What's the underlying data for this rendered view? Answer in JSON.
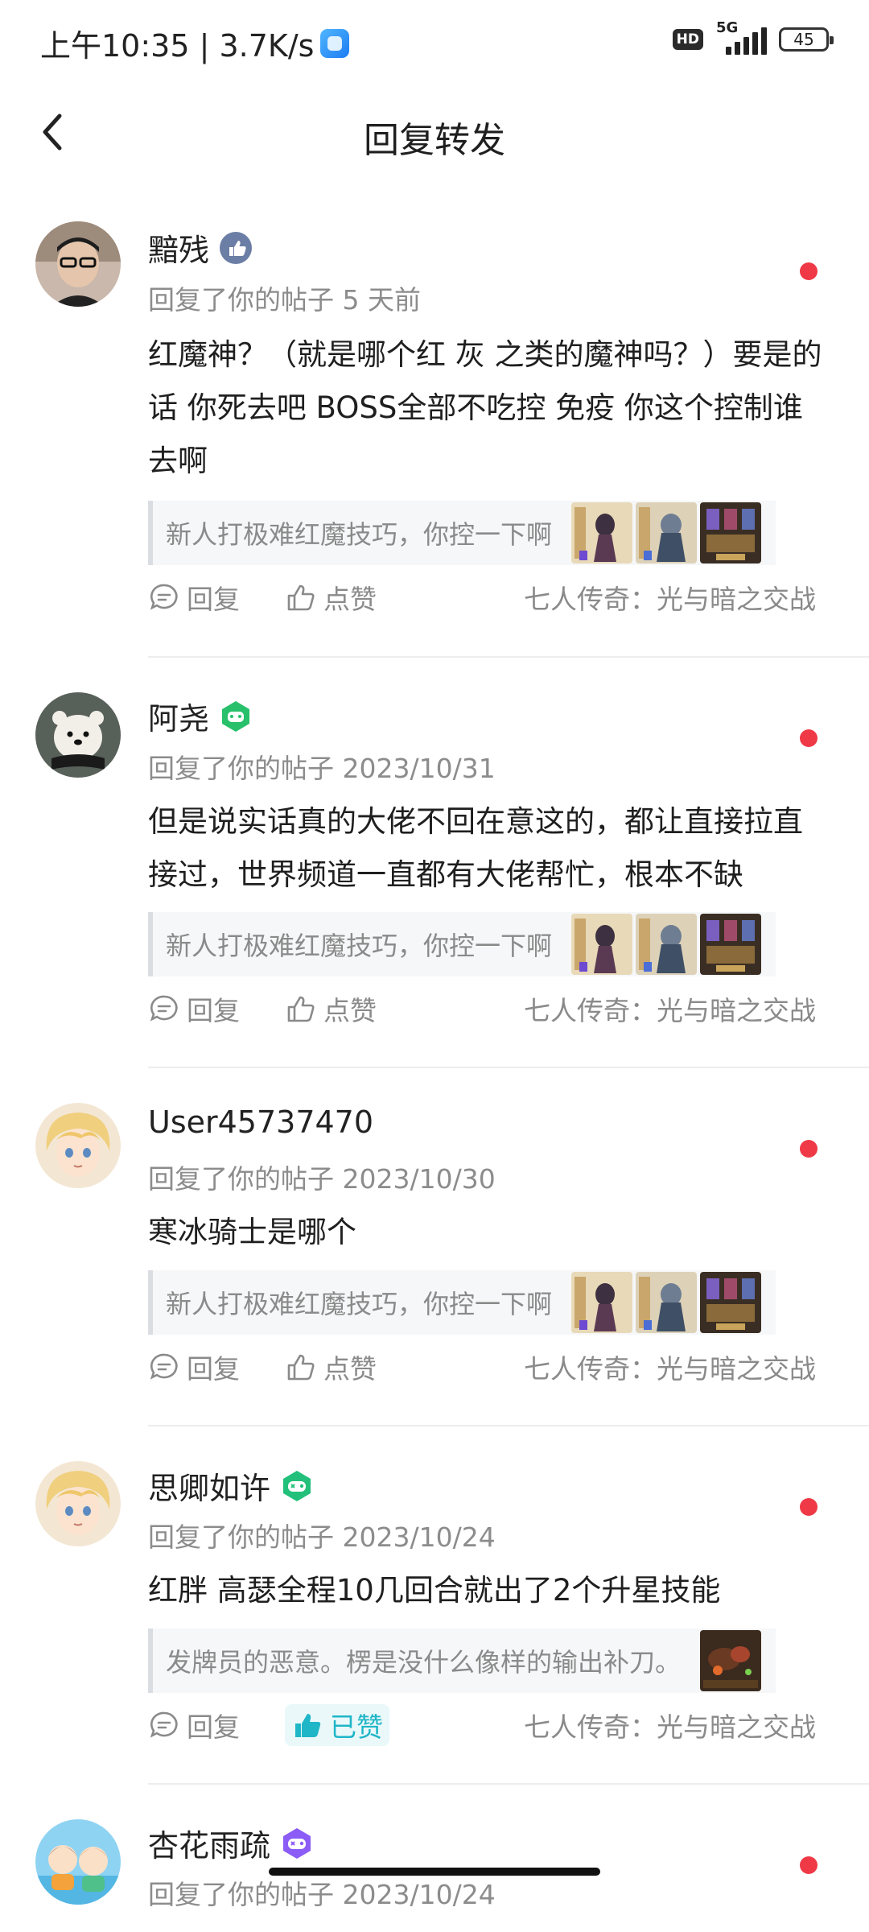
{
  "status_bar": {
    "time_speed": "上午10:35 | 3.7K/s",
    "hd": "HD",
    "network": "5G",
    "battery": "45"
  },
  "header": {
    "title": "回复转发"
  },
  "feed": [
    {
      "username": "黯残",
      "badge": "thumb-badge-icon",
      "meta": "回复了你的帖子 5 天前",
      "content": "红魔神？（就是哪个红 灰 之类的魔神吗？）要是的话 你死去吧 BOSS全部不吃控 免疫 你这个控制谁去啊",
      "quote": "新人打极难红魔技巧，你控一下啊",
      "reply_label": "回复",
      "like_label": "点赞",
      "liked": false,
      "game": "七人传奇：光与暗之交战"
    },
    {
      "username": "阿尧",
      "badge": "green-gamepad-badge-icon",
      "meta": "回复了你的帖子 2023/10/31",
      "content": "但是说实话真的大佬不回在意这的，都让直接拉直接过，世界频道一直都有大佬帮忙，根本不缺",
      "quote": "新人打极难红魔技巧，你控一下啊",
      "reply_label": "回复",
      "like_label": "点赞",
      "liked": false,
      "game": "七人传奇：光与暗之交战"
    },
    {
      "username": "User45737470",
      "badge": "",
      "meta": "回复了你的帖子 2023/10/30",
      "content": "寒冰骑士是哪个",
      "quote": "新人打极难红魔技巧，你控一下啊",
      "reply_label": "回复",
      "like_label": "点赞",
      "liked": false,
      "game": "七人传奇：光与暗之交战"
    },
    {
      "username": "思卿如许",
      "badge": "green-controller-badge-icon",
      "meta": "回复了你的帖子 2023/10/24",
      "content": "红胖  高瑟全程10几回合就出了2个升星技能",
      "quote": "发牌员的恶意。楞是没什么像样的输出补刀。",
      "reply_label": "回复",
      "like_label": "已赞",
      "liked": true,
      "game": "七人传奇：光与暗之交战"
    },
    {
      "username": "杏花雨疏",
      "badge": "purple-controller-badge-icon",
      "meta": "回复了你的帖子 2023/10/24"
    }
  ],
  "colors": {
    "accent_liked": "#1fb6c7",
    "unread_dot": "#ef3946",
    "secondary_text": "#8a8a8a"
  }
}
